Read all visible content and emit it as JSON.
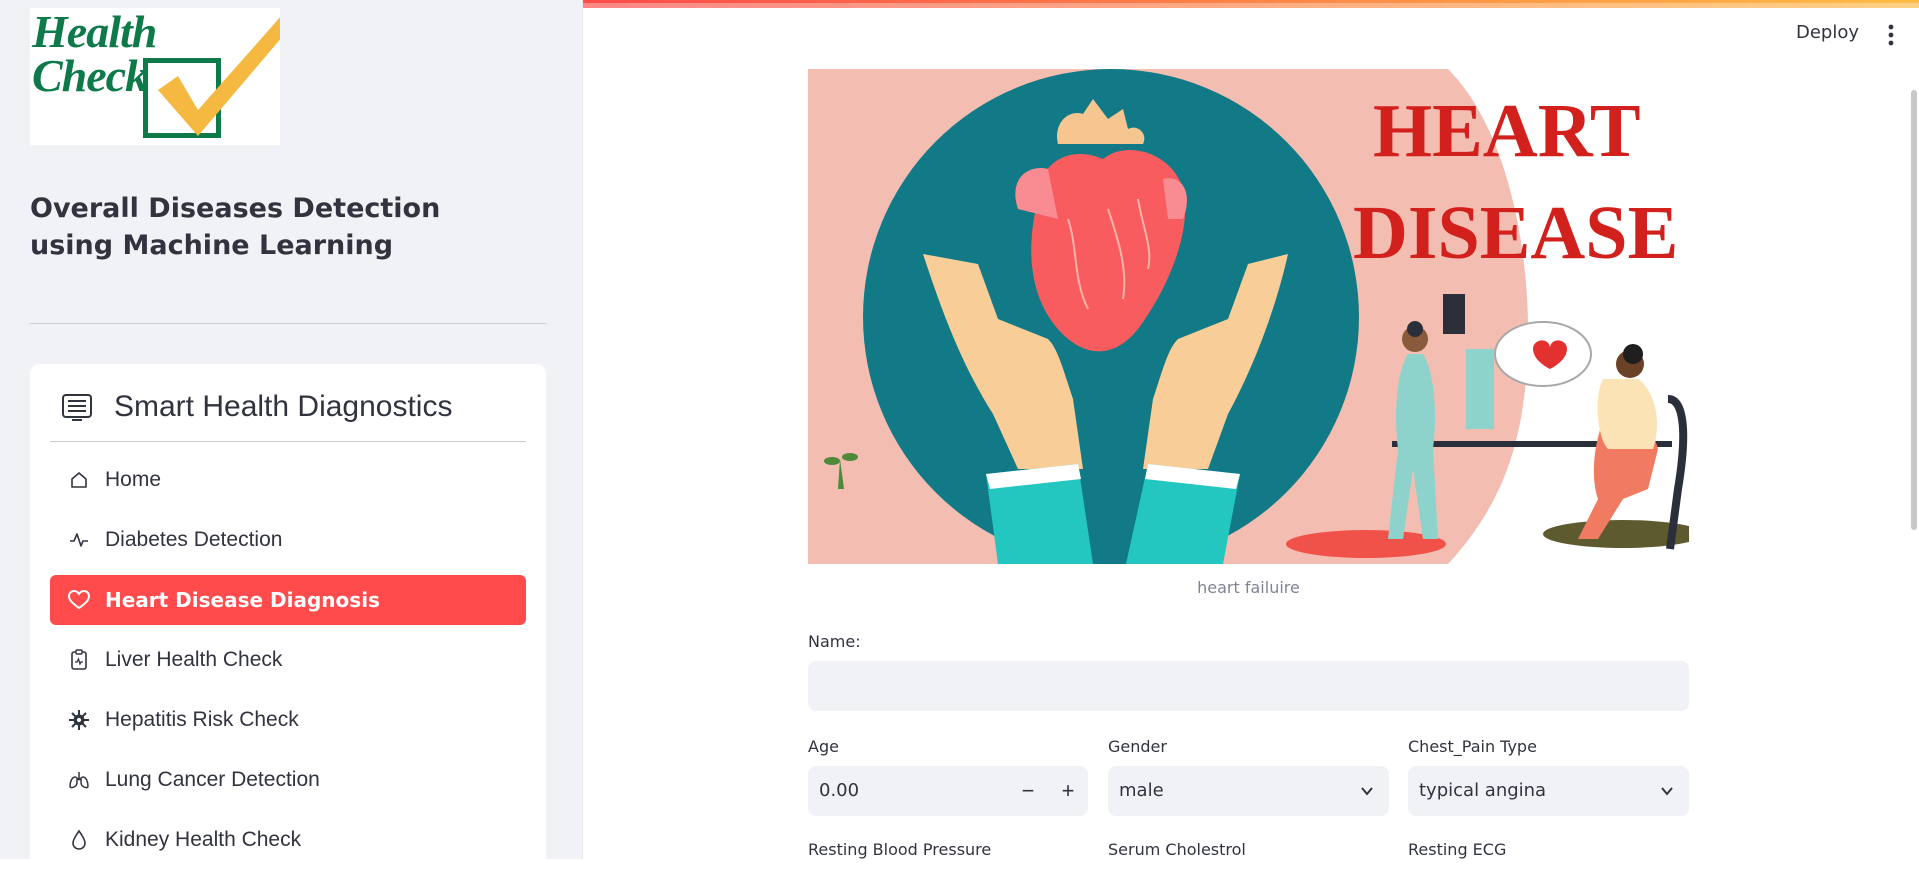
{
  "app": {
    "logo_text_line1": "Health",
    "logo_text_line2": "Check",
    "title": "Overall Diseases Detection using Machine Learning"
  },
  "menu": {
    "header_icon": "list-card-icon",
    "header_title": "Smart Health Diagnostics",
    "items": [
      {
        "label": "Home",
        "icon": "house-icon",
        "active": false
      },
      {
        "label": "Diabetes Detection",
        "icon": "pulse-icon",
        "active": false
      },
      {
        "label": "Heart Disease Diagnosis",
        "icon": "heart-icon",
        "active": true
      },
      {
        "label": "Liver Health Check",
        "icon": "clipboard-pulse-icon",
        "active": false
      },
      {
        "label": "Hepatitis Risk Check",
        "icon": "virus-icon",
        "active": false
      },
      {
        "label": "Lung Cancer Detection",
        "icon": "lungs-icon",
        "active": false
      },
      {
        "label": "Kidney Health Check",
        "icon": "droplet-icon",
        "active": false
      }
    ]
  },
  "header": {
    "deploy_label": "Deploy",
    "menu_icon": "kebab-menu-icon"
  },
  "banner": {
    "title_line1": "HEART",
    "title_line2": "DISEASE",
    "caption": "heart failuire"
  },
  "form": {
    "name_label": "Name:",
    "name_value": "",
    "age_label": "Age",
    "age_value": "0.00",
    "age_minus": "−",
    "age_plus": "+",
    "gender_label": "Gender",
    "gender_value": "male",
    "chest_pain_label": "Chest_Pain Type",
    "chest_pain_value": "typical angina",
    "resting_bp_label": "Resting Blood Pressure",
    "cholesterol_label": "Serum Cholestrol",
    "resting_ecg_label": "Resting ECG"
  },
  "colors": {
    "accent": "#ff4b4b",
    "sidebar_bg": "#f0f2f6",
    "banner_teal": "#127a86",
    "banner_pink": "#f4bdb2",
    "banner_red": "#d2201d"
  }
}
